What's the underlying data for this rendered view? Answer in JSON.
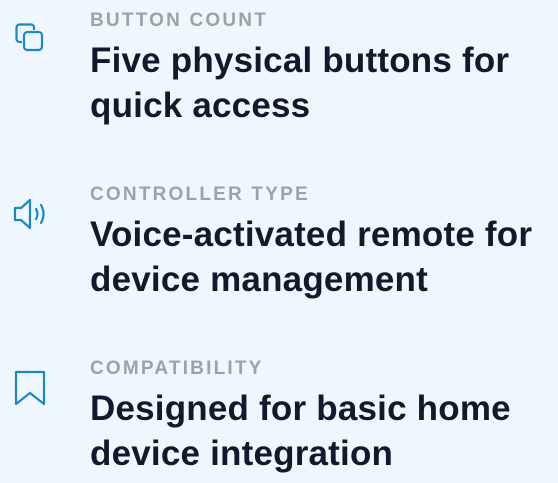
{
  "theme": {
    "background": "#eff6fe",
    "accent": "#1a87c9",
    "label_color": "#9aa3ad",
    "value_color": "#111a2c"
  },
  "features": [
    {
      "icon": "copy-icon",
      "label": "BUTTON COUNT",
      "value": "Five physical buttons for quick access"
    },
    {
      "icon": "speaker-icon",
      "label": "CONTROLLER TYPE",
      "value": "Voice-activated remote for device management"
    },
    {
      "icon": "bookmark-icon",
      "label": "COMPATIBILITY",
      "value": "Designed for basic home device integration"
    }
  ]
}
